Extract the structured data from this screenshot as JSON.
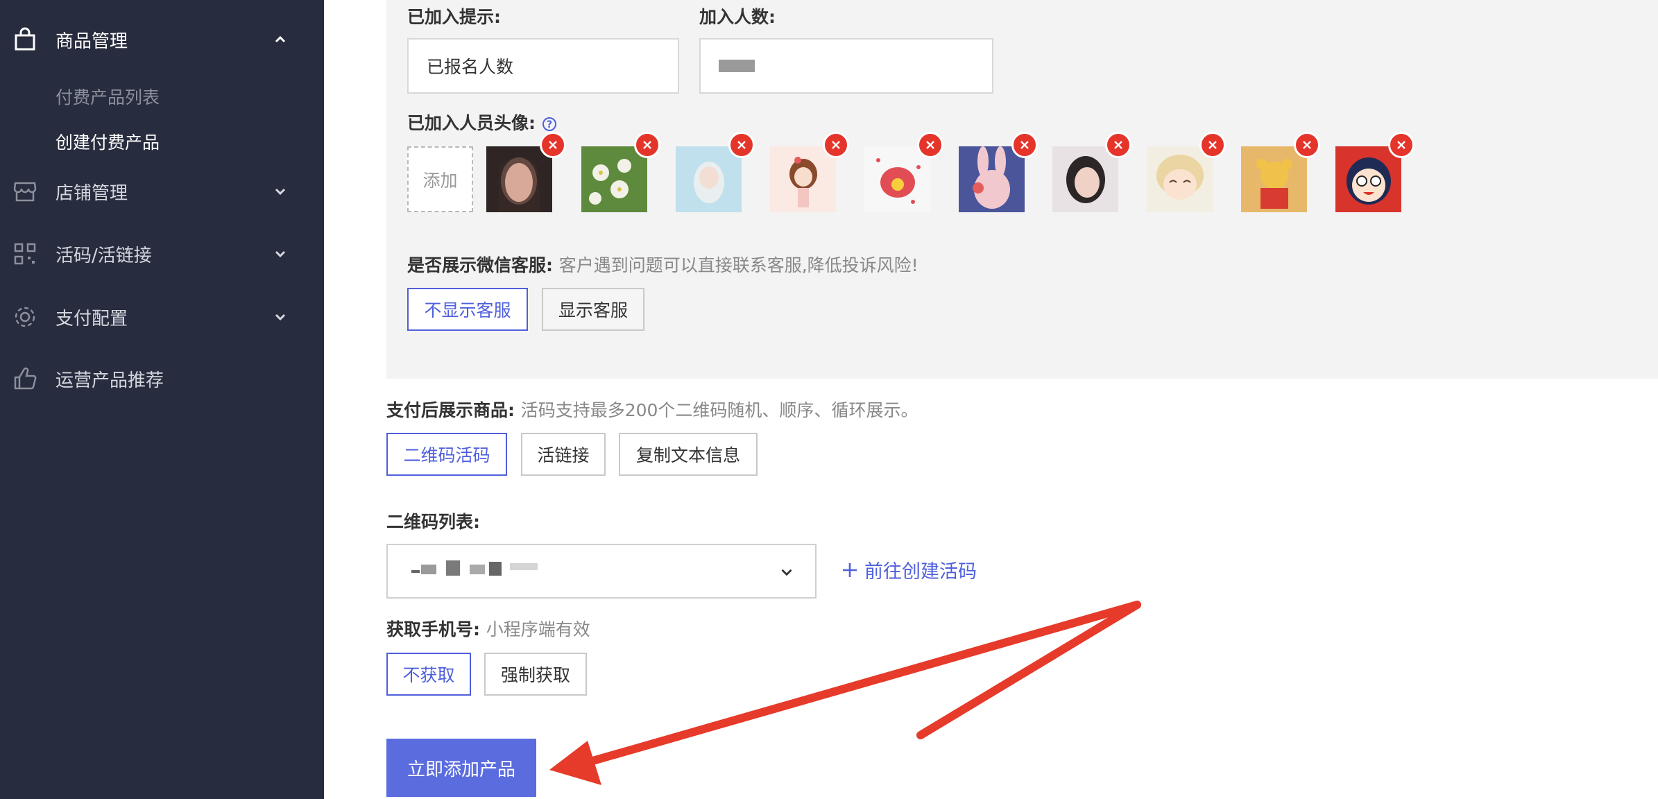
{
  "sidebar": {
    "items": [
      {
        "label": "商品管理",
        "icon": "bag-icon",
        "expanded": true
      },
      {
        "label": "店铺管理",
        "icon": "store-icon"
      },
      {
        "label": "活码/活链接",
        "icon": "qrcode-icon"
      },
      {
        "label": "支付配置",
        "icon": "gear-icon"
      },
      {
        "label": "运营产品推荐",
        "icon": "thumbs-up-icon"
      }
    ],
    "subitems": [
      "付费产品列表",
      "创建付费产品"
    ]
  },
  "form": {
    "joined_tip_label": "已加入提示:",
    "joined_tip_value": "已报名人数",
    "joined_count_label": "加入人数:",
    "avatars_label": "已加入人员头像:",
    "avatar_add_label": "添加",
    "wechat_label": "是否展示微信客服:",
    "wechat_hint": "客户遇到问题可以直接联系客服,降低投诉风险!",
    "wechat_options": [
      "不显示客服",
      "显示客服"
    ],
    "show_goods_label": "支付后展示商品:",
    "show_goods_hint": "活码支持最多200个二维码随机、顺序、循环展示。",
    "show_goods_options": [
      "二维码活码",
      "活链接",
      "复制文本信息"
    ],
    "qr_list_label": "二维码列表:",
    "create_link": "前往创建活码",
    "phone_label": "获取手机号:",
    "phone_hint": "小程序端有效",
    "phone_options": [
      "不获取",
      "强制获取"
    ],
    "submit": "立即添加产品"
  },
  "colors": {
    "sidebar_bg": "#272c3e",
    "accent": "#4f5fdc",
    "submit_bg": "#5b6cde",
    "remove_red": "#e5352b",
    "arrow": "#e63a2a"
  }
}
